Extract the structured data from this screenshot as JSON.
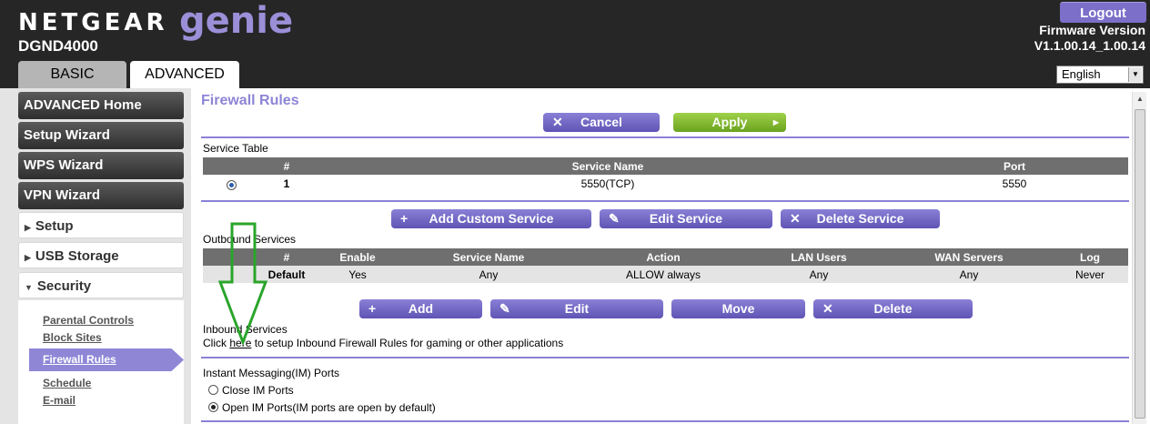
{
  "header": {
    "brand": "NETGEAR",
    "product": "genie",
    "trademark": "™",
    "model": "DGND4000",
    "logout_label": "Logout",
    "firmware_label": "Firmware Version",
    "firmware_version": "V1.1.00.14_1.00.14",
    "language": "English",
    "tabs": [
      "BASIC",
      "ADVANCED"
    ]
  },
  "sidebar": {
    "dark_items": [
      "ADVANCED Home",
      "Setup Wizard",
      "WPS Wizard",
      "VPN Wizard"
    ],
    "sections": [
      "Setup",
      "USB Storage",
      "Security"
    ],
    "security_items": [
      "Parental Controls",
      "Block Sites",
      "Firewall Rules",
      "Schedule",
      "E-mail"
    ],
    "selected": "Firewall Rules"
  },
  "main": {
    "title": "Firewall Rules",
    "cancel_label": "Cancel",
    "apply_label": "Apply",
    "service_table": {
      "label": "Service Table",
      "columns": [
        "#",
        "Service Name",
        "Port"
      ],
      "rows": [
        {
          "num": "1",
          "name": "5550(TCP)",
          "port": "5550"
        }
      ]
    },
    "service_buttons": [
      "Add Custom Service",
      "Edit Service",
      "Delete Service"
    ],
    "outbound": {
      "label": "Outbound Services",
      "columns": [
        "#",
        "Enable",
        "Service Name",
        "Action",
        "LAN Users",
        "WAN Servers",
        "Log"
      ],
      "rows": [
        {
          "num": "Default",
          "enable": "Yes",
          "service": "Any",
          "action": "ALLOW always",
          "lan": "Any",
          "wan": "Any",
          "log": "Never"
        }
      ]
    },
    "outbound_buttons": [
      "Add",
      "Edit",
      "Move",
      "Delete"
    ],
    "inbound": {
      "label": "Inbound Services",
      "text_before": "Click ",
      "link": "here",
      "text_after": " to setup Inbound Firewall Rules for gaming or other applications"
    },
    "im": {
      "label": "Instant Messaging(IM) Ports",
      "options": [
        "Close IM Ports",
        "Open IM Ports(IM ports are open by default)"
      ],
      "selected": "Open IM Ports(IM ports are open by default)"
    }
  },
  "colors": {
    "accent": "#8a80d6",
    "apply_green": "#84bd30",
    "annotation_arrow": "#2aa52a"
  }
}
